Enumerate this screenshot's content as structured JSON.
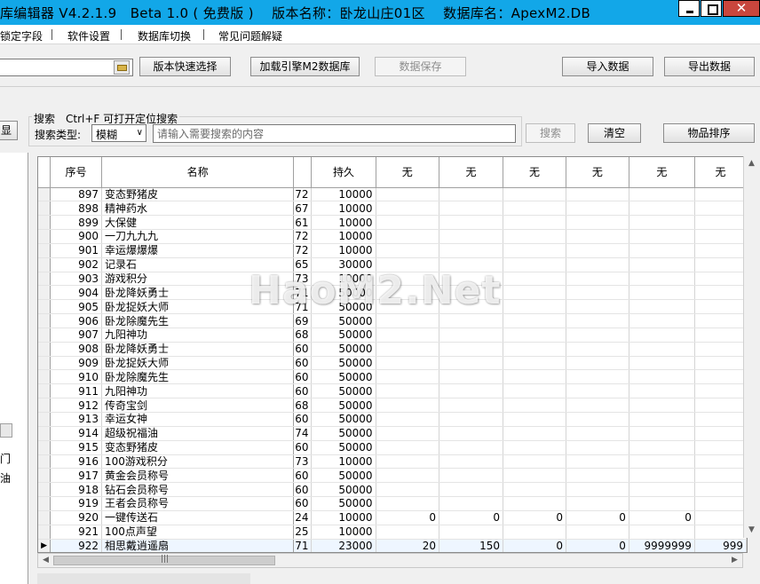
{
  "window": {
    "title": "库编辑器 V4.2.1.9　Beta 1.0 ( 免费版 )　 版本名称：卧龙山庄01区　 数据库名：ApexM2.DB",
    "close_label": "✕"
  },
  "menu": {
    "items": [
      "锁定字段",
      "软件设置",
      "数据库切换",
      "常见问题解疑"
    ]
  },
  "toolbar": {
    "version_select_label": "版本快速选择",
    "load_db_label": "加载引擎M2数据库",
    "save_data_label": "数据保存",
    "import_label": "导入数据",
    "export_label": "导出数据"
  },
  "search": {
    "left_btn_fragment": "显",
    "hint": "搜索　Ctrl+F 可打开定位搜索",
    "type_label": "搜索类型:",
    "type_value": "模糊",
    "placeholder": "请输入需要搜索的内容",
    "search_btn": "搜索",
    "clear_btn": "清空",
    "sort_btn": "物品排序"
  },
  "left_panel": {
    "frag1": "门",
    "frag2": "油"
  },
  "watermark": "HaoM2.Net",
  "grid": {
    "columns": [
      "序号",
      "名称",
      "",
      "持久",
      "无",
      "无",
      "无",
      "无",
      "无",
      "无"
    ],
    "rows": [
      [
        "897",
        "变态野猪皮",
        "72",
        "10000",
        "",
        "",
        "",
        "",
        "",
        ""
      ],
      [
        "898",
        "精神药水",
        "67",
        "10000",
        "",
        "",
        "",
        "",
        "",
        ""
      ],
      [
        "899",
        "大保健",
        "61",
        "10000",
        "",
        "",
        "",
        "",
        "",
        ""
      ],
      [
        "900",
        "一刀九九九",
        "72",
        "10000",
        "",
        "",
        "",
        "",
        "",
        ""
      ],
      [
        "901",
        "幸运爆爆爆",
        "72",
        "10000",
        "",
        "",
        "",
        "",
        "",
        ""
      ],
      [
        "902",
        "记录石",
        "65",
        "30000",
        "",
        "",
        "",
        "",
        "",
        ""
      ],
      [
        "903",
        "游戏积分",
        "73",
        "10000",
        "",
        "",
        "",
        "",
        "",
        ""
      ],
      [
        "904",
        "卧龙降妖勇士",
        "71",
        "50000",
        "",
        "",
        "",
        "",
        "",
        ""
      ],
      [
        "905",
        "卧龙捉妖大师",
        "71",
        "50000",
        "",
        "",
        "",
        "",
        "",
        ""
      ],
      [
        "906",
        "卧龙除魔先生",
        "69",
        "50000",
        "",
        "",
        "",
        "",
        "",
        ""
      ],
      [
        "907",
        "九阳神功",
        "68",
        "50000",
        "",
        "",
        "",
        "",
        "",
        ""
      ],
      [
        "908",
        "卧龙降妖勇士",
        "60",
        "50000",
        "",
        "",
        "",
        "",
        "",
        ""
      ],
      [
        "909",
        "卧龙捉妖大师",
        "60",
        "50000",
        "",
        "",
        "",
        "",
        "",
        ""
      ],
      [
        "910",
        "卧龙除魔先生",
        "60",
        "50000",
        "",
        "",
        "",
        "",
        "",
        ""
      ],
      [
        "911",
        "九阳神功",
        "60",
        "50000",
        "",
        "",
        "",
        "",
        "",
        ""
      ],
      [
        "912",
        "传奇宝剑",
        "68",
        "50000",
        "",
        "",
        "",
        "",
        "",
        ""
      ],
      [
        "913",
        "幸运女神",
        "60",
        "50000",
        "",
        "",
        "",
        "",
        "",
        ""
      ],
      [
        "914",
        "超级祝福油",
        "74",
        "50000",
        "",
        "",
        "",
        "",
        "",
        ""
      ],
      [
        "915",
        "变态野猪皮",
        "60",
        "50000",
        "",
        "",
        "",
        "",
        "",
        ""
      ],
      [
        "916",
        "100游戏积分",
        "73",
        "10000",
        "",
        "",
        "",
        "",
        "",
        ""
      ],
      [
        "917",
        "黄金会员称号",
        "60",
        "50000",
        "",
        "",
        "",
        "",
        "",
        ""
      ],
      [
        "918",
        "钻石会员称号",
        "60",
        "50000",
        "",
        "",
        "",
        "",
        "",
        ""
      ],
      [
        "919",
        "王者会员称号",
        "60",
        "50000",
        "",
        "",
        "",
        "",
        "",
        ""
      ],
      [
        "920",
        "一键传送石",
        "24",
        "10000",
        "0",
        "0",
        "0",
        "0",
        "0",
        ""
      ],
      [
        "921",
        "100点声望",
        "25",
        "10000",
        "",
        "",
        "",
        "",
        "",
        ""
      ],
      [
        "922",
        "相思戴逍遥扇",
        "71",
        "23000",
        "20",
        "150",
        "0",
        "0",
        "9999999",
        "999"
      ]
    ],
    "selected_row": 25,
    "row_indicator": "▶"
  },
  "scrollbars": {
    "hthumb_glyph": "|||",
    "up": "▲",
    "down": "▼",
    "left": "◀",
    "right": "▶"
  }
}
